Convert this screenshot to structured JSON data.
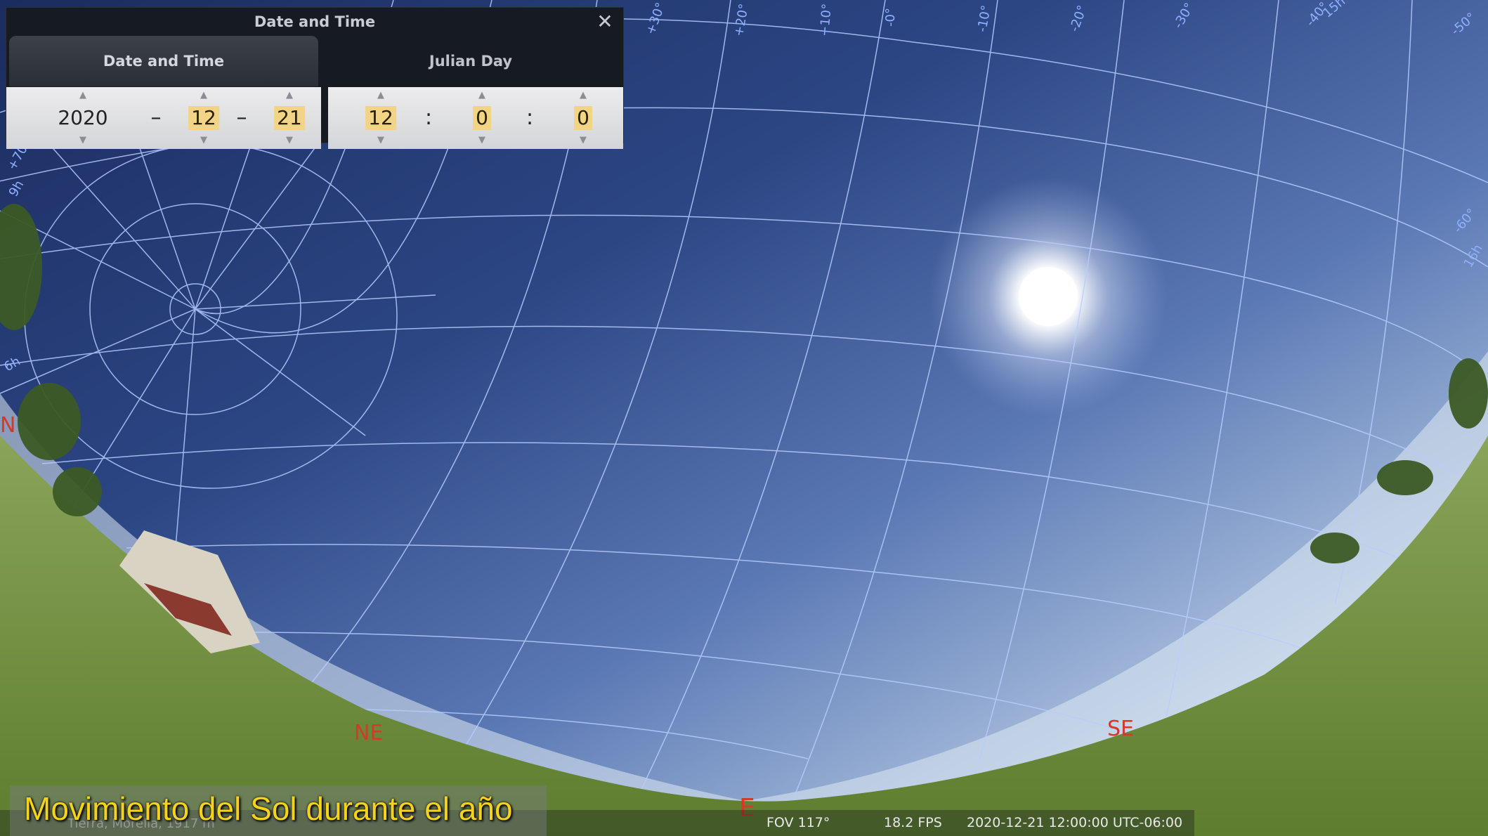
{
  "dialog": {
    "title": "Date and Time",
    "tabs": [
      {
        "label": "Date and Time",
        "active": true
      },
      {
        "label": "Julian Day",
        "active": false
      }
    ],
    "date": {
      "year": "2020",
      "month": "12",
      "day": "21",
      "separator": "–"
    },
    "time": {
      "hour": "12",
      "minute": "0",
      "second": "0",
      "separator": ":"
    },
    "close_icon": "close-icon"
  },
  "sky": {
    "cardinals": {
      "ne": "NE",
      "e": "E",
      "se": "SE",
      "n": "N"
    },
    "ra_labels": [
      "9h",
      "6h",
      "15h",
      "16h"
    ],
    "dec_labels": [
      "+70°",
      "+30°",
      "+20°",
      "+10°",
      "-0°",
      "-10°",
      "-20°",
      "-30°",
      "-40°",
      "-50°",
      "-60°"
    ]
  },
  "status": {
    "location": "Tierra, Morelia, 1917 m",
    "fov": "FOV 117°",
    "fps": "18.2 FPS",
    "datetime": "2020-12-21 12:00:00 UTC-06:00"
  },
  "caption": "Movimiento del Sol durante el año",
  "colors": {
    "accent_highlight": "#f1d486",
    "caption": "#f5d21b",
    "cardinal": "#d23a2a",
    "grid": "#a9c4ff"
  }
}
